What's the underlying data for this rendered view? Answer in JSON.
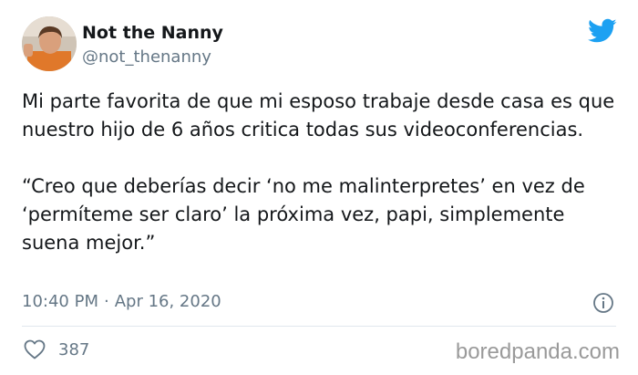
{
  "author": {
    "display_name": "Not the Nanny",
    "handle": "@not_thenanny"
  },
  "tweet": {
    "paragraphs": [
      "Mi parte favorita de que mi esposo trabaje desde casa es que  nuestro hijo de 6 años critica todas sus videoconferencias.",
      "“Creo que deberías decir ‘no me malinterpretes’ en vez de ‘permíteme ser claro’ la próxima vez, papi, simplemente suena mejor.”"
    ],
    "time": "10:40 PM",
    "separator": "·",
    "date": "Apr 16, 2020",
    "likes": "387"
  },
  "icons": {
    "platform": "twitter-bird-icon",
    "info": "info-icon",
    "like": "heart-icon"
  },
  "colors": {
    "brand": "#1da1f2",
    "text": "#14171a",
    "secondary": "#657786",
    "divider": "#e1e8ed"
  },
  "watermark": "boredpanda.com"
}
